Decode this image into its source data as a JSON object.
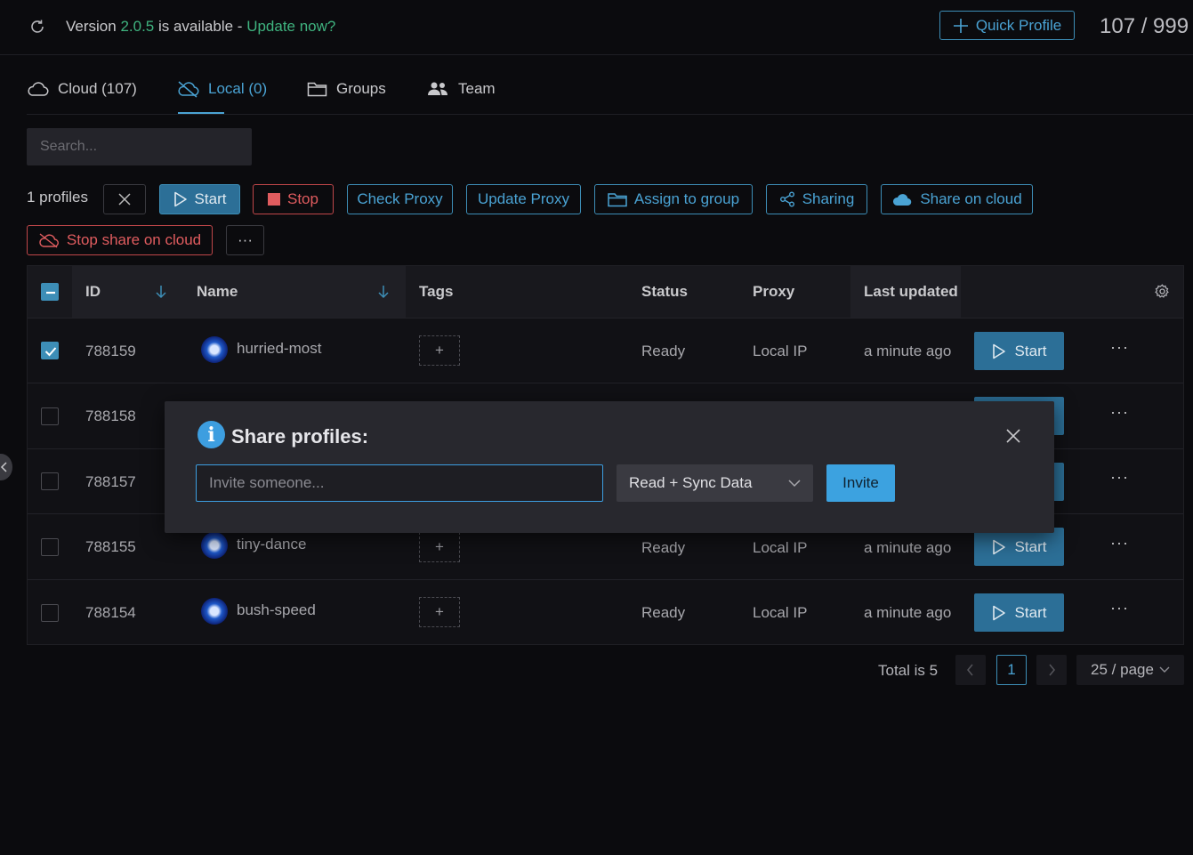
{
  "topbar": {
    "version_prefix": "Version ",
    "version": "2.0.5",
    "version_suffix": " is available - ",
    "update_link": "Update now?",
    "quick_profile": "Quick Profile",
    "profile_count": "107 / 999"
  },
  "tabs": [
    {
      "label": "Cloud (107)",
      "icon": "cloud-icon"
    },
    {
      "label": "Local (0)",
      "icon": "cloud-off-icon",
      "active": true
    },
    {
      "label": "Groups",
      "icon": "folder-icon"
    },
    {
      "label": "Team",
      "icon": "team-icon"
    }
  ],
  "search": {
    "placeholder": "Search..."
  },
  "toolbar": {
    "selected_count": "1 profiles",
    "start": "Start",
    "stop": "Stop",
    "check_proxy": "Check Proxy",
    "update_proxy": "Update Proxy",
    "assign_group": "Assign to group",
    "sharing": "Sharing",
    "share_cloud": "Share on cloud",
    "stop_share_cloud": "Stop share on cloud",
    "more": "···"
  },
  "table": {
    "columns": [
      "ID",
      "Name",
      "Tags",
      "Status",
      "Proxy",
      "Last updated"
    ],
    "rows": [
      {
        "id": "788159",
        "name": "hurried-most",
        "status": "Ready",
        "proxy": "Local IP",
        "updated": "a minute ago",
        "checked": true
      },
      {
        "id": "788158",
        "name": "",
        "status": "",
        "proxy": "",
        "updated": "",
        "checked": false
      },
      {
        "id": "788157",
        "name": "",
        "status": "",
        "proxy": "",
        "updated": "",
        "checked": false
      },
      {
        "id": "788155",
        "name": "tiny-dance",
        "status": "Ready",
        "proxy": "Local IP",
        "updated": "a minute ago",
        "checked": false
      },
      {
        "id": "788154",
        "name": "bush-speed",
        "status": "Ready",
        "proxy": "Local IP",
        "updated": "a minute ago",
        "checked": false
      }
    ],
    "row_start_label": "Start",
    "row_more": "···",
    "tag_add": "+"
  },
  "pagination": {
    "total": "Total is 5",
    "current_page": "1",
    "page_size": "25 / page"
  },
  "modal": {
    "title": "Share profiles:",
    "input_placeholder": "Invite someone...",
    "permission": "Read + Sync Data",
    "invite": "Invite"
  },
  "colors": {
    "accent": "#3d8eb7",
    "green": "#3fb37f",
    "danger": "#e05c5f",
    "background": "#0b0b0e"
  }
}
